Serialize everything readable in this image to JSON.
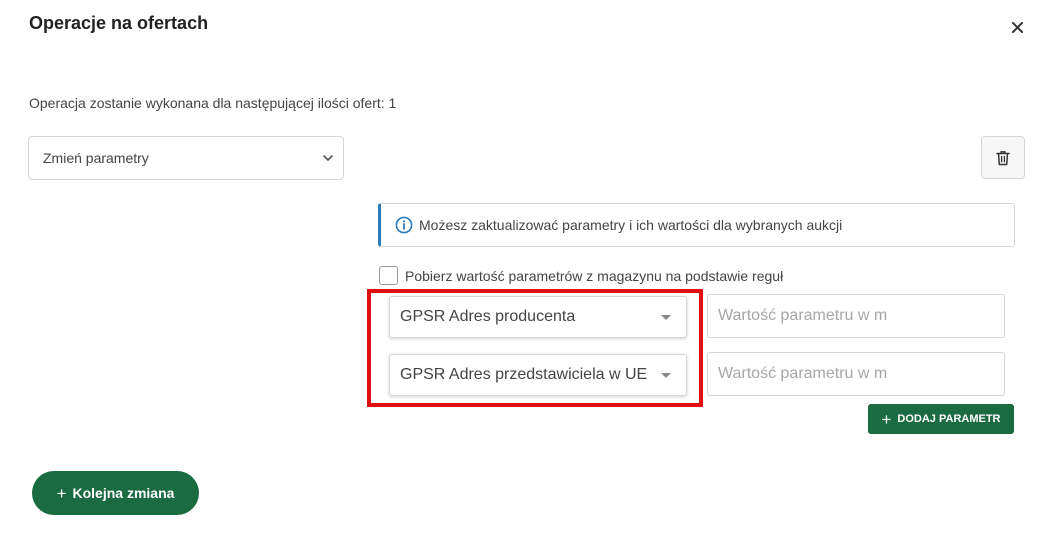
{
  "modal": {
    "title": "Operacje na ofertach",
    "close_icon": "close-icon"
  },
  "summary": {
    "text": "Operacja zostanie wykonana dla następującej ilości ofert: 1"
  },
  "operation": {
    "selected": "Zmień parametry",
    "chevron_icon": "chevron-down-icon",
    "delete_icon": "trash-icon"
  },
  "info": {
    "icon": "info-icon",
    "text": "Możesz zaktualizować parametry i ich wartości dla wybranych aukcji",
    "accent_color": "#2b7bb9"
  },
  "warehouse": {
    "label": "Pobierz wartość parametrów z magazynu na podstawie reguł",
    "checked": false
  },
  "parameters": [
    {
      "name": "GPSR Adres producenta",
      "value": "",
      "placeholder": "Wartość parametru w m"
    },
    {
      "name": "GPSR Adres przedstawiciela w UE",
      "value": "",
      "placeholder": "Wartość parametru w m"
    }
  ],
  "highlight_color": "#e01010",
  "add_param": {
    "plus": "+",
    "label": "DODAJ PARAMETR"
  },
  "next_change": {
    "plus": "+",
    "label": "Kolejna zmiana"
  },
  "brand_color": "#1a6b3f"
}
